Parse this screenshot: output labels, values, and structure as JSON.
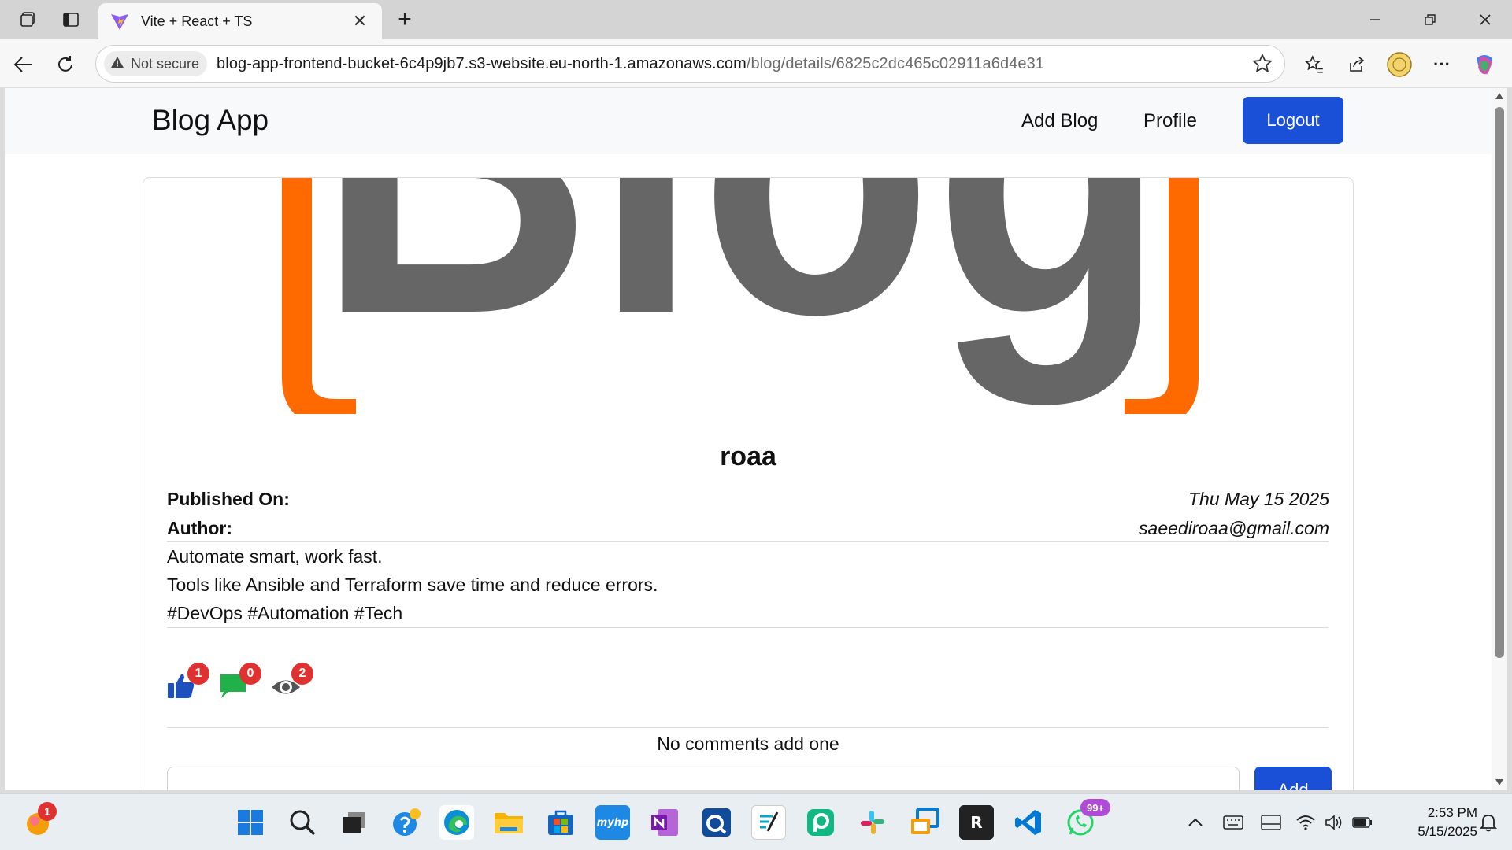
{
  "browser": {
    "tab_title": "Vite + React + TS",
    "security_label": "Not secure",
    "url_host": "blog-app-frontend-bucket-6c4p9jb7.s3-website.eu-north-1.amazonaws.com",
    "url_path": "/blog/details/6825c2dc465c02911a6d4e31"
  },
  "navbar": {
    "brand": "Blog App",
    "add_blog": "Add Blog",
    "profile": "Profile",
    "logout": "Logout"
  },
  "post": {
    "cover_text": "Blog",
    "title": "roaa",
    "published_label": "Published On:",
    "published_value": "Thu May 15 2025",
    "author_label": "Author:",
    "author_value": "saeediroaa@gmail.com",
    "body": [
      "Automate smart, work fast.",
      "Tools like Ansible and Terraform save time and reduce errors.",
      "#DevOps #Automation #Tech"
    ],
    "stats": {
      "likes": "1",
      "comments": "0",
      "views": "2"
    },
    "no_comments": "No comments add one",
    "add_button": "Add"
  },
  "taskbar": {
    "widgets_badge": "1",
    "whatsapp_badge": "99+",
    "time": "2:53 PM",
    "date": "5/15/2025"
  },
  "colors": {
    "primary": "#1a4fd8",
    "like": "#1d4fbf",
    "comment": "#22b04b",
    "badge": "#e03131",
    "cover_orange": "#ff6a00",
    "cover_gray": "#666666"
  }
}
